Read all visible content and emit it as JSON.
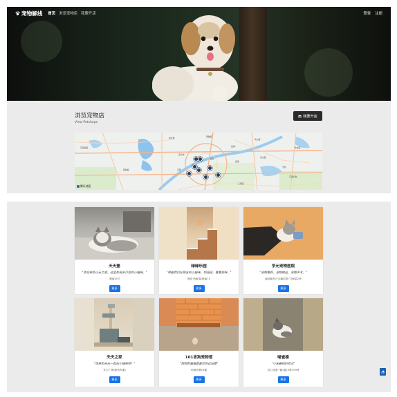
{
  "navbar": {
    "brand": "宠物解线",
    "items": [
      "首页",
      "浏览宠物店",
      "我要开店"
    ],
    "right": [
      "登录",
      "注册"
    ]
  },
  "browse": {
    "title": "浏览宠物店",
    "subtitle": "View Petshops",
    "open_button": "我要开店"
  },
  "map": {
    "attribution": "腾讯地图",
    "labels": [
      "东西湖区",
      "盘龙城",
      "后湖",
      "武昌",
      "洪山区",
      "汉阳",
      "武汉",
      "光谷",
      "东湖高新",
      "蔡甸区",
      "江夏区",
      "青山区",
      "武汉市",
      "黄陂区",
      "新洲区"
    ],
    "pin_count": 7
  },
  "shops": [
    {
      "name": "夭夭堡",
      "quote": "\"欢迎来到小夭之家。这里有很多可爱的小猫咪。\"",
      "address": "黑街中村",
      "button": "更多"
    },
    {
      "name": "绿绿乐园",
      "quote": "\"带着我们好朋友的小猫咪。到园园，看看那咪...\"",
      "address": "莲花·柏家湾(西南门)",
      "button": "更多"
    },
    {
      "name": "亨元宠物医院",
      "quote": "\"宠物看养、宠物绝益、宠物手术。\"",
      "address": "湖河路东汗汉福宅宠广场6层2号",
      "button": "更多"
    },
    {
      "name": "夭夭之家",
      "quote": "\"快来和夭夭一起玩小猫咪吧！\"",
      "address": "东力广场(新州大道)",
      "button": "更多"
    },
    {
      "name": "101忠狗宠物馆",
      "quote": "\"狗狗和猫猫都喜欢在这玩耍\"",
      "address": "司城大厦18楼",
      "button": "更多"
    },
    {
      "name": "喵雀楼",
      "quote": "\"小夭最招的有点\"",
      "address": "洪上自强一路5路-5栋109号",
      "button": "更多"
    }
  ],
  "back_to_top": "TOP",
  "icons": [
    "paw-icon",
    "shop-icon",
    "chevron-up-icon"
  ],
  "colors": {
    "primary_button": "#1a73e8",
    "dark_button": "#2a2a2a",
    "section_bg": "#ebebeb"
  }
}
